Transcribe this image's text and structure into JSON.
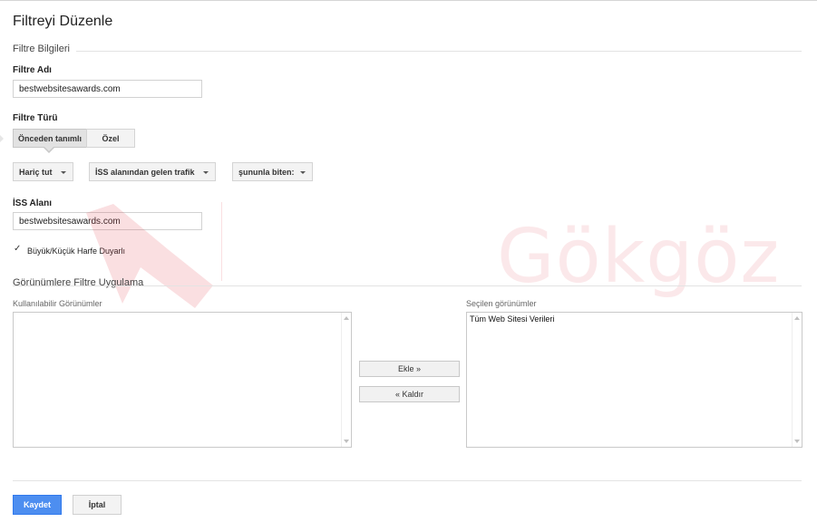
{
  "page": {
    "title": "Filtreyi Düzenle"
  },
  "filter_info": {
    "section_title": "Filtre Bilgileri",
    "name_label": "Filtre Adı",
    "name_value": "bestwebsitesawards.com",
    "type_label": "Filtre Türü",
    "type_options": {
      "predefined": "Önceden tanımlı",
      "custom": "Özel"
    },
    "selected_type": "predefined",
    "dropdowns": {
      "action": "Hariç tut",
      "field": "İSS alanından gelen trafik",
      "operator": "şununla biten:"
    },
    "isp_label": "İSS Alanı",
    "isp_value": "bestwebsitesawards.com",
    "case_sensitive_label": "Büyük/Küçük Harfe Duyarlı",
    "case_sensitive_checked": true
  },
  "apply_views": {
    "section_title": "Görünümlere Filtre Uygulama",
    "available_label": "Kullanılabilir Görünümler",
    "available_items": [],
    "selected_label": "Seçilen görünümler",
    "selected_items": [
      "Tüm Web Sitesi Verileri"
    ],
    "add_button": "Ekle »",
    "remove_button": "« Kaldır"
  },
  "footer": {
    "save_button": "Kaydet",
    "cancel_button": "İptal"
  },
  "watermark": {
    "text": "Gökgöz",
    "color": "#e23c4a"
  },
  "colors": {
    "primary_button": "#4d8ef0"
  }
}
